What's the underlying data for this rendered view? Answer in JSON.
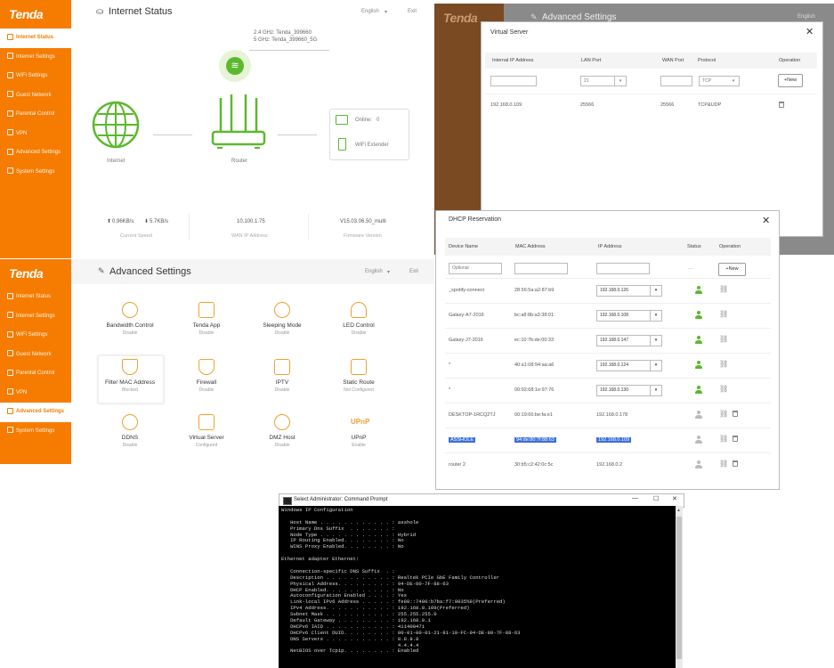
{
  "brand": "Tenda",
  "sidebar_items": [
    "Internet Status",
    "Internet Settings",
    "WiFi Settings",
    "Guest Network",
    "Parental Control",
    "VPN",
    "Advanced Settings",
    "System Settings"
  ],
  "status_panel": {
    "title": "Internet Status",
    "lang": "English",
    "exit": "Exit",
    "wifi_24": "2.4 GHz: Tenda_399660",
    "wifi_5": "5 GHz: Tenda_399660_5G",
    "internet_label": "Internet",
    "router_label": "Router",
    "online_label": "Online:",
    "online_count": "0",
    "extender_label": "WiFi Extender",
    "up_speed": "0.96KB/s",
    "down_speed": "5.7KB/s",
    "speed_caption": "Current Speed",
    "wan_ip": "10.100.1.75",
    "wan_caption": "WAN IP Address",
    "firmware": "V15.03.06.50_multi",
    "firmware_caption": "Firmware Version"
  },
  "advanced_panel": {
    "title": "Advanced Settings",
    "lang": "English",
    "exit": "Exit",
    "features": [
      {
        "label": "Bandwidth Control",
        "status": "Disable"
      },
      {
        "label": "Tenda App",
        "status": "Disable"
      },
      {
        "label": "Sleeping Mode",
        "status": "Disable"
      },
      {
        "label": "LED Control",
        "status": "Disable"
      },
      {
        "label": "Filter MAC Address",
        "status": "Blocked"
      },
      {
        "label": "Firewall",
        "status": "Disable"
      },
      {
        "label": "IPTV",
        "status": "Disable"
      },
      {
        "label": "Static Route",
        "status": "Not Configured"
      },
      {
        "label": "DDNS",
        "status": "Disable"
      },
      {
        "label": "Virtual Server",
        "status": "Configured"
      },
      {
        "label": "DMZ Host",
        "status": "Disable"
      },
      {
        "label": "UPnP",
        "status": "Enable"
      }
    ]
  },
  "bg_advanced": {
    "title": "Advanced Settings",
    "lang": "English"
  },
  "virtual_server": {
    "title": "Virtual Server",
    "headers": [
      "Internal IP Address",
      "LAN Port",
      "WAN Port",
      "Protocol",
      "Operation"
    ],
    "lan_port_value": "21",
    "protocol_value": "TCP",
    "new_button": "+New",
    "row": {
      "ip": "192.168.0.109",
      "lan": "25566",
      "wan": "25566",
      "proto": "TCP&UDP"
    }
  },
  "dhcp": {
    "title": "DHCP Reservation",
    "headers": [
      "Device Name",
      "MAC Address",
      "IP Address",
      "Status",
      "Operation"
    ],
    "optional_placeholder": "Optional",
    "status_dash": "---",
    "new_button": "+New",
    "rows": [
      {
        "name": "_spotify-connect",
        "mac": "28:56:5a:a2:87:b9",
        "ip": "192.168.0.126"
      },
      {
        "name": "Galaxy-A7-2016",
        "mac": "bc:a8:8b:a3:38:01",
        "ip": "192.168.0.108"
      },
      {
        "name": "Galaxy-J7-2016",
        "mac": "ec:10:7b:de:00:33",
        "ip": "192.168.0.147"
      },
      {
        "name": "*",
        "mac": "40:a1:08:94:aa:a6",
        "ip": "192.168.0.124"
      },
      {
        "name": "*",
        "mac": "00:92:68:1e:97:76",
        "ip": "192.168.0.130"
      },
      {
        "name": "DESKTOP-1RCQ2TJ",
        "mac": "00:19:66:be:fa:e1",
        "ip": "192.168.0.178"
      },
      {
        "name": "ASSHOLE",
        "mac": "94:de:80:7f:88:63",
        "ip": "192.168.0.109"
      },
      {
        "name": "router 2",
        "mac": "30:b5:c2:42:0c:5c",
        "ip": "192.168.0.2"
      }
    ]
  },
  "cmd": {
    "title": "Select Administrator: Command Prompt",
    "min": "—",
    "max": "☐",
    "close": "✕",
    "lines": [
      "Windows IP Configuration",
      "",
      "   Host Name . . . . . . . . . . . . : asshole",
      "   Primary Dns Suffix  . . . . . . . :",
      "   Node Type . . . . . . . . . . . . : Hybrid",
      "   IP Routing Enabled. . . . . . . . : No",
      "   WINS Proxy Enabled. . . . . . . . : No",
      "",
      "Ethernet adapter Ethernet:",
      "",
      "   Connection-specific DNS Suffix  . :",
      "   Description . . . . . . . . . . . : Realtek PCIe GbE Family Controller",
      "   Physical Address. . . . . . . . . : 94-DE-80-7F-88-63",
      "   DHCP Enabled. . . . . . . . . . . : No",
      "   Autoconfiguration Enabled . . . . : Yes",
      "   Link-local IPv6 Address . . . . . : fe80::7400:b7ba:f7:9835%9(Preferred)",
      "   IPv4 Address. . . . . . . . . . . : 192.168.0.109(Preferred)",
      "   Subnet Mask . . . . . . . . . . . : 255.255.255.0",
      "   Default Gateway . . . . . . . . . : 192.168.0.1",
      "   DHCPv6 IAID . . . . . . . . . . . : 411400471",
      "   DHCPv6 Client DUID. . . . . . . . : 00-01-00-01-21-81-10-FC-94-DE-80-7F-88-63",
      "   DNS Servers . . . . . . . . . . . : 8.8.8.8",
      "                                       4.4.4.4",
      "   NetBIOS over Tcpip. . . . . . . . : Enabled"
    ]
  }
}
